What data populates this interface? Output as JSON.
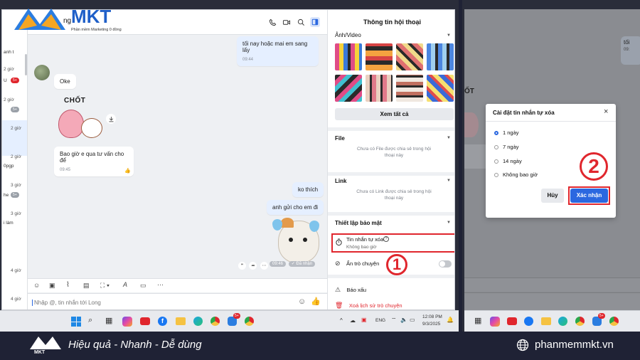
{
  "brand": {
    "name": "MKT",
    "tagline": "Phần mềm Marketing 0 đồng"
  },
  "left_window": {
    "chat_name_fragment": "ng",
    "sidebar_items": [
      {
        "text": "anh t"
      },
      {
        "text": "2 giờ",
        "sub": "U",
        "badge": "5+"
      },
      {
        "text": "2 giờ",
        "badge": "5+"
      },
      {
        "text": "2 giờ"
      },
      {
        "text": "2 giờ",
        "sub": "0pgp"
      },
      {
        "text": "3 giờ",
        "sub": "he",
        "badge": "5+"
      },
      {
        "text": "3 giờ",
        "sub": "i làm"
      },
      {
        "text": "4 giờ"
      },
      {
        "text": "4 giờ"
      }
    ],
    "messages": {
      "m1": {
        "text": "tối nay hoặc mai em sang lấy",
        "time": "09:44"
      },
      "m2": {
        "text": "Oke"
      },
      "sticker_text": "CHỐT",
      "m3": {
        "text": "Bao giờ e qua tư vấn cho để",
        "time": "09:45"
      },
      "m4": {
        "text": "ko thích"
      },
      "m5": {
        "text": "anh gửi cho em đi"
      },
      "sticker_time": "09:46",
      "sticker_status": "Đã nhận"
    },
    "input_placeholder": "Nhập @, tin nhắn tới Long",
    "info_panel": {
      "title": "Thông tin hội thoại",
      "media_heading": "Ảnh/Video",
      "view_all": "Xem tất cả",
      "file_heading": "File",
      "file_note": "Chưa có File được chia sẻ trong hội thoại này",
      "link_heading": "Link",
      "link_note": "Chưa có Link được chia sẻ trong hội thoại này",
      "security_heading": "Thiết lập bảo mật",
      "auto_delete_label": "Tin nhắn tự xóa",
      "auto_delete_value": "Không bao giờ",
      "hide_chat": "Ẩn trò chuyện",
      "report": "Báo xấu",
      "delete_history": "Xoá lịch sử trò chuyện"
    },
    "step_label": "①",
    "taskbar": {
      "lang": "ENG",
      "time": "12:08 PM",
      "date": "9/3/2025",
      "badge": "5+"
    }
  },
  "right_window": {
    "msg_fragment": "tối",
    "msg_fragment2": "09:",
    "dialog": {
      "title": "Cài đặt tin nhắn tự xóa",
      "options": [
        "1 ngày",
        "7 ngày",
        "14 ngày",
        "Không bao giờ"
      ],
      "selected": 0,
      "cancel": "Hủy",
      "confirm": "Xác nhận"
    },
    "step_label": "②"
  },
  "footer": {
    "slogan": "Hiệu quả - Nhanh - Dễ dùng",
    "website": "phanmemmkt.vn"
  },
  "colors": {
    "accent": "#2b68e0",
    "highlight": "#e0262d",
    "footer_bg": "#1f2235"
  }
}
